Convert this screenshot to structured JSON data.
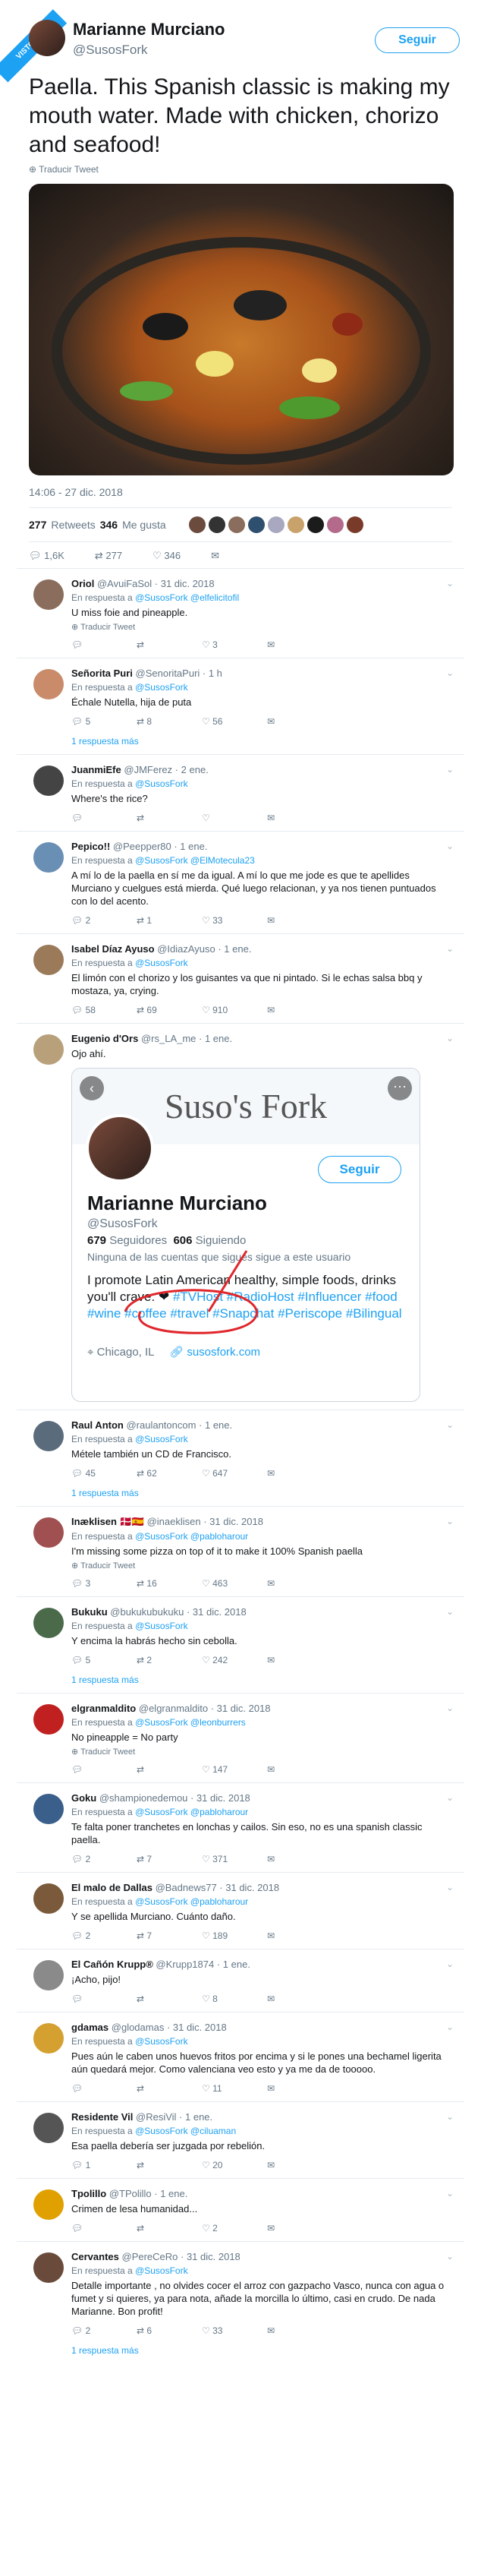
{
  "watermark": "VISTO EN VAYAGIF.COM",
  "tweet": {
    "author_name": "Marianne Murciano",
    "author_handle": "@SusosFork",
    "follow_label": "Seguir",
    "text": "Paella. This Spanish classic is making my mouth water. Made with chicken, chorizo and seafood!",
    "translate": "Traducir Tweet",
    "timestamp": "14:06 - 27 dic. 2018",
    "retweets_count": "277",
    "retweets_label": "Retweets",
    "likes_count": "346",
    "likes_label": "Me gusta",
    "reply_count": "1,6K",
    "retweet_count_small": "277",
    "like_count_small": "346"
  },
  "replies": [
    {
      "name": "Oriol",
      "handle": "@AvuiFaSol · 31 dic. 2018",
      "in_reply": "En respuesta a",
      "to": "@SusosFork @elfelicitofil",
      "text": "U miss foie and pineapple.",
      "translate": "Traducir Tweet",
      "r": "",
      "rt": "",
      "l": "3",
      "more": ""
    },
    {
      "name": "Señorita Puri",
      "handle": "@SenoritaPuri · 1 h",
      "in_reply": "En respuesta a",
      "to": "@SusosFork",
      "text": "Échale Nutella, hija de puta",
      "translate": "",
      "r": "5",
      "rt": "8",
      "l": "56",
      "more": "1 respuesta más"
    },
    {
      "name": "JuanmiEfe",
      "handle": "@JMFerez · 2 ene.",
      "in_reply": "En respuesta a",
      "to": "@SusosFork",
      "text": "Where's the rice?",
      "translate": "",
      "r": "",
      "rt": "",
      "l": "",
      "more": ""
    },
    {
      "name": "Pepico!!",
      "handle": "@Peepper80 · 1 ene.",
      "in_reply": "En respuesta a",
      "to": "@SusosFork @ElMotecula23",
      "text": "A mí lo de la paella en sí me da igual. A mí lo que me jode es que te apellides Murciano y cuelgues está mierda. Qué luego relacionan, y ya nos tienen puntuados con lo del acento.",
      "translate": "",
      "r": "2",
      "rt": "1",
      "l": "33",
      "more": ""
    },
    {
      "name": "Isabel Díaz Ayuso",
      "handle": "@IdiazAyuso · 1 ene.",
      "in_reply": "En respuesta a",
      "to": "@SusosFork",
      "text": "El limón con el chorizo y los guisantes va que ni pintado. Si le echas salsa bbq y mostaza, ya, crying.",
      "translate": "",
      "r": "58",
      "rt": "69",
      "l": "910",
      "more": ""
    },
    {
      "name": "Eugenio d'Ors",
      "handle": "@rs_LA_me · 1 ene.",
      "in_reply": "",
      "to": "",
      "text": "Ojo ahí.",
      "translate": "",
      "r": "",
      "rt": "",
      "l": "",
      "more": ""
    },
    {
      "name": "Raul Anton",
      "handle": "@raulantoncom · 1 ene.",
      "in_reply": "En respuesta a",
      "to": "@SusosFork",
      "text": "Métele también un CD de Francisco.",
      "translate": "",
      "r": "45",
      "rt": "62",
      "l": "647",
      "more": "1 respuesta más"
    },
    {
      "name": "Inæklisen 🇩🇰🇪🇸",
      "handle": "@inaeklisen · 31 dic. 2018",
      "in_reply": "En respuesta a",
      "to": "@SusosFork @pabloharour",
      "text": "I'm missing some pizza on top of it to make it 100% Spanish paella",
      "translate": "Traducir Tweet",
      "r": "3",
      "rt": "16",
      "l": "463",
      "more": ""
    },
    {
      "name": "Bukuku",
      "handle": "@bukukubukuku · 31 dic. 2018",
      "in_reply": "En respuesta a",
      "to": "@SusosFork",
      "text": "Y encima la habrás hecho sin cebolla.",
      "translate": "",
      "r": "5",
      "rt": "2",
      "l": "242",
      "more": "1 respuesta más"
    },
    {
      "name": "elgranmaldito",
      "handle": "@elgranmaldito · 31 dic. 2018",
      "in_reply": "En respuesta a",
      "to": "@SusosFork @leonburrers",
      "text": "No pineapple = No party",
      "translate": "Traducir Tweet",
      "r": "",
      "rt": "",
      "l": "147",
      "more": ""
    },
    {
      "name": "Goku",
      "handle": "@shampionedemou · 31 dic. 2018",
      "in_reply": "En respuesta a",
      "to": "@SusosFork @pabloharour",
      "text": "Te falta poner tranchetes en lonchas y cailos. Sin eso, no es una spanish classic paella.",
      "translate": "",
      "r": "2",
      "rt": "7",
      "l": "371",
      "more": ""
    },
    {
      "name": "El malo de Dallas",
      "handle": "@Badnews77 · 31 dic. 2018",
      "in_reply": "En respuesta a",
      "to": "@SusosFork @pabloharour",
      "text": "Y se apellida Murciano. Cuánto daño.",
      "translate": "",
      "r": "2",
      "rt": "7",
      "l": "189",
      "more": ""
    },
    {
      "name": "El Cañón Krupp®",
      "handle": "@Krupp1874 · 1 ene.",
      "in_reply": "",
      "to": "",
      "text": "¡Acho, pijo!",
      "translate": "",
      "r": "",
      "rt": "",
      "l": "8",
      "more": ""
    },
    {
      "name": "gdamas",
      "handle": "@glodamas · 31 dic. 2018",
      "in_reply": "En respuesta a",
      "to": "@SusosFork",
      "text": "Pues aún le caben unos huevos fritos por encima y si le pones una bechamel ligerita aún quedará mejor. Como valenciana veo esto y ya me da de tooooo.",
      "translate": "",
      "r": "",
      "rt": "",
      "l": "11",
      "more": ""
    },
    {
      "name": "Residente Vil",
      "handle": "@ResiVil · 1 ene.",
      "in_reply": "En respuesta a",
      "to": "@SusosFork @ciluaman",
      "text": "Esa paella debería ser juzgada por rebelión.",
      "translate": "",
      "r": "1",
      "rt": "",
      "l": "20",
      "more": ""
    },
    {
      "name": "Tpolillo",
      "handle": "@TPolillo · 1 ene.",
      "in_reply": "",
      "to": "",
      "text": "Crimen de lesa humanidad...",
      "translate": "",
      "r": "",
      "rt": "",
      "l": "2",
      "more": ""
    },
    {
      "name": "Cervantes",
      "handle": "@PereCeRo · 31 dic. 2018",
      "in_reply": "En respuesta a",
      "to": "@SusosFork",
      "text": "Detalle importante , no olvides cocer el arroz con gazpacho Vasco, nunca con agua o fumet y si quieres, ya para nota, añade la morcilla lo último, casi en crudo. De nada Marianne. Bon profit!",
      "translate": "",
      "r": "2",
      "rt": "6",
      "l": "33",
      "more": "1 respuesta más"
    }
  ],
  "embed": {
    "banner_title": "Suso's Fork",
    "name": "Marianne Murciano",
    "handle": "@SusosFork",
    "following_count": "679",
    "following_label": "Seguidores",
    "followers_count": "606",
    "followers_label": "Siguiendo",
    "none_follow": "Ninguna de las cuentas que sigues sigue a este usuario",
    "bio_plain": "I promote Latin American healthy, simple foods, drinks you'll crave. ❤",
    "bio_tags": "#TVHost #RadioHost #Influencer #food #wine #coffee #travel #Snapchat #Periscope #Bilingual",
    "location": "Chicago, IL",
    "link": "susosfork.com",
    "follow_label": "Seguir"
  },
  "colors": {
    "accent": "#1da1f2",
    "muted": "#657786",
    "border": "#e6ecf0",
    "scribble": "#e0262b"
  }
}
